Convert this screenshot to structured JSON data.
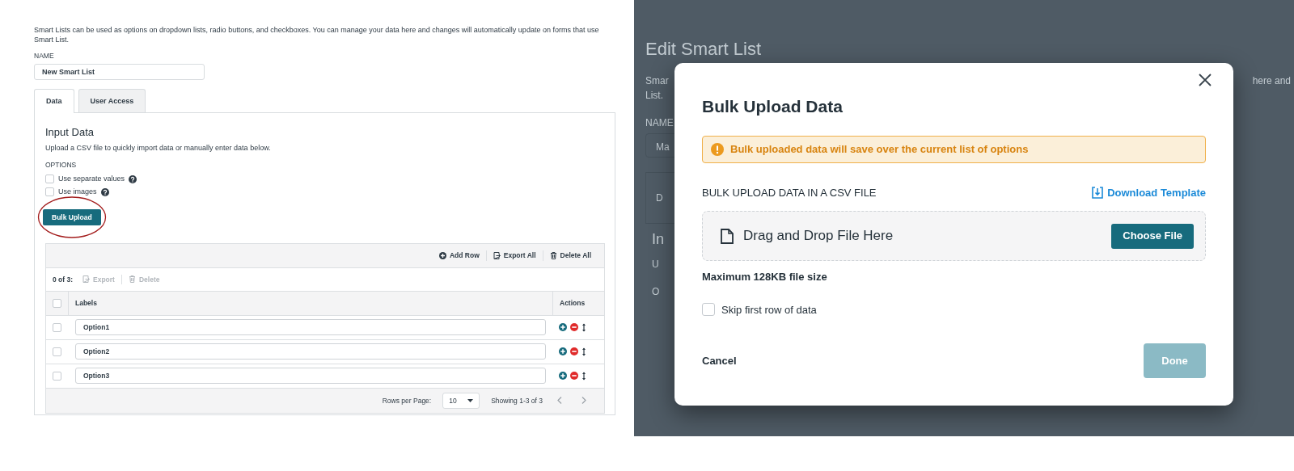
{
  "smart_list_form": {
    "description": "Smart Lists can be used as options on dropdown lists, radio buttons, and checkboxes. You can manage your data here and changes will automatically update on forms that use Smart List.",
    "name_label": "NAME",
    "name_value": "New Smart List",
    "tabs": [
      {
        "label": "Data",
        "selected": true
      },
      {
        "label": "User Access",
        "selected": false
      }
    ],
    "section_title": "Input Data",
    "section_subtitle": "Upload a CSV file to quickly import data or manually enter data below.",
    "options_label": "OPTIONS",
    "options": [
      {
        "label": "Use separate values",
        "checked": false
      },
      {
        "label": "Use images",
        "checked": false
      }
    ],
    "bulk_upload_button": "Bulk Upload",
    "toolbar": [
      {
        "label": "Add Row",
        "kind": "add"
      },
      {
        "label": "Export All",
        "kind": "export"
      },
      {
        "label": "Delete All",
        "kind": "delete"
      }
    ],
    "selection_count": "0 of 3:",
    "selection_actions": [
      {
        "label": "Export",
        "kind": "export",
        "disabled": true
      },
      {
        "label": "Delete",
        "kind": "delete",
        "disabled": true
      }
    ],
    "select_all": {
      "checked": false
    },
    "table": {
      "columns": [
        "Labels",
        "Actions"
      ],
      "rows": [
        {
          "label": "Option1",
          "selected": false
        },
        {
          "label": "Option2",
          "selected": false
        },
        {
          "label": "Option3",
          "selected": false
        }
      ]
    },
    "rows_per_page_label": "Rows per Page:",
    "rows_per_page": "10",
    "showing": "Showing 1-3 of 3"
  },
  "background_page": {
    "title": "Edit Smart List",
    "description_start": "Smar",
    "description_end": "here and",
    "description_line_2": "List.",
    "name_label": "NAME",
    "name_value": "Ma",
    "tab": "D",
    "section_title": "In",
    "section_subtitle": "U",
    "options_label": "O"
  },
  "modal": {
    "title": "Bulk Upload Data",
    "warning": "Bulk uploaded data will save over the current list of options",
    "section_label": "BULK UPLOAD DATA IN A CSV FILE",
    "download_link": "Download Template",
    "drop_text": "Drag and Drop File Here",
    "choose_button": "Choose File",
    "max_size": "Maximum 128KB file size",
    "skip_first_row": {
      "label": "Skip first row of data",
      "checked": false
    },
    "cancel": "Cancel",
    "done": {
      "label": "Done",
      "disabled": true
    }
  }
}
